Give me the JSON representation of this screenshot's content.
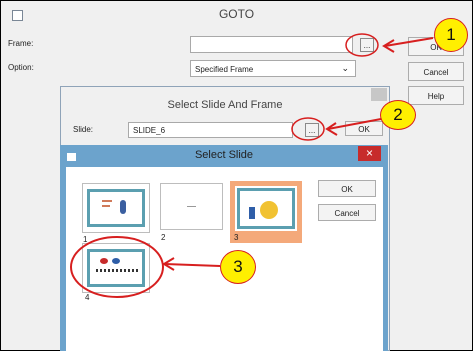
{
  "goto": {
    "title": "GOTO",
    "frame_label": "Frame:",
    "frame_value": "",
    "browse_label": "...",
    "option_label": "Option:",
    "option_value": "Specified Frame",
    "ok_label": "OK",
    "cancel_label": "Cancel",
    "help_label": "Help"
  },
  "select_slide_frame": {
    "title": "Select Slide And Frame",
    "slide_label": "Slide:",
    "slide_value": "SLIDE_6",
    "browse_label": "...",
    "ok_label": "OK"
  },
  "select_slide": {
    "title": "Select Slide",
    "close_label": "×",
    "ok_label": "OK",
    "cancel_label": "Cancel",
    "thumbnails": [
      {
        "number": "1"
      },
      {
        "number": "2"
      },
      {
        "number": "3"
      },
      {
        "number": "4"
      }
    ]
  },
  "annotations": [
    "1",
    "2",
    "3"
  ],
  "colors": {
    "callout_fill": "#ffef00",
    "callout_stroke": "#d71f1f",
    "dialog_border": "#6ca3cc",
    "selected_highlight": "#f4a97a"
  }
}
